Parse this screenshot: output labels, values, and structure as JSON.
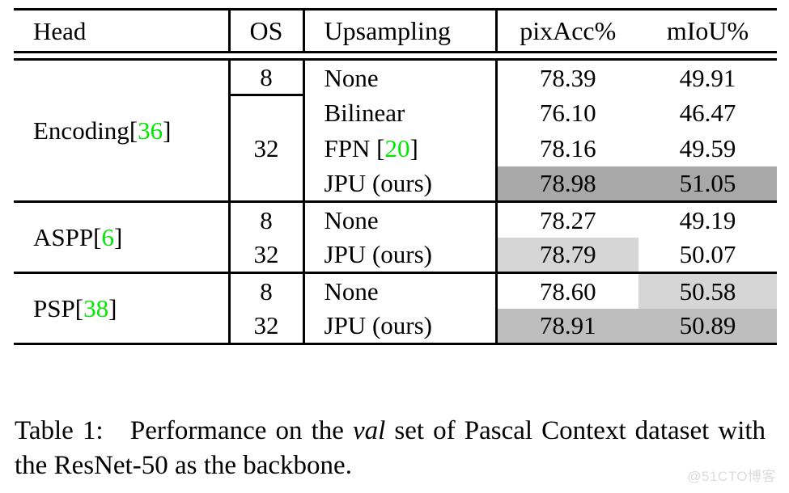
{
  "table": {
    "columns": [
      "Head",
      "OS",
      "Upsampling",
      "pixAcc%",
      "mIoU%"
    ],
    "groups": [
      {
        "head": "Encoding",
        "head_cite_open": "[",
        "head_cite": "36",
        "head_cite_close": "]",
        "rows": [
          {
            "os": "8",
            "upsampling": "None",
            "upsampling_cite": "",
            "pixacc": "78.39",
            "miou": "49.91"
          },
          {
            "os": "32",
            "upsampling": "Bilinear",
            "upsampling_cite": "",
            "pixacc": "76.10",
            "miou": "46.47"
          },
          {
            "os": "",
            "upsampling": "FPN",
            "upsampling_cite": "20",
            "pixacc": "78.16",
            "miou": "49.59"
          },
          {
            "os": "",
            "upsampling": "JPU (ours)",
            "upsampling_cite": "",
            "pixacc": "78.98",
            "miou": "51.05"
          }
        ]
      },
      {
        "head": "ASPP",
        "head_cite_open": "[",
        "head_cite": "6",
        "head_cite_close": "]",
        "rows": [
          {
            "os": "8",
            "upsampling": "None",
            "upsampling_cite": "",
            "pixacc": "78.27",
            "miou": "49.19"
          },
          {
            "os": "32",
            "upsampling": "JPU (ours)",
            "upsampling_cite": "",
            "pixacc": "78.79",
            "miou": "50.07"
          }
        ]
      },
      {
        "head": "PSP",
        "head_cite_open": "[",
        "head_cite": "38",
        "head_cite_close": "]",
        "rows": [
          {
            "os": "8",
            "upsampling": "None",
            "upsampling_cite": "",
            "pixacc": "78.60",
            "miou": "50.58"
          },
          {
            "os": "32",
            "upsampling": "JPU (ours)",
            "upsampling_cite": "",
            "pixacc": "78.91",
            "miou": "50.89"
          }
        ]
      }
    ]
  },
  "caption": {
    "label": "Table 1:",
    "text_before_italic": "Performance on the",
    "italic": "val",
    "text_after_italic": "set of Pascal Context dataset with the ResNet-50 as the backbone."
  },
  "watermark": {
    "text": "@51CTO博客"
  },
  "colors": {
    "citation_green": "#00e800",
    "highlight_dark": "#a8a8a8",
    "highlight_medium": "#bebebe",
    "highlight_light": "#d6d6d6",
    "rule": "#000000"
  }
}
